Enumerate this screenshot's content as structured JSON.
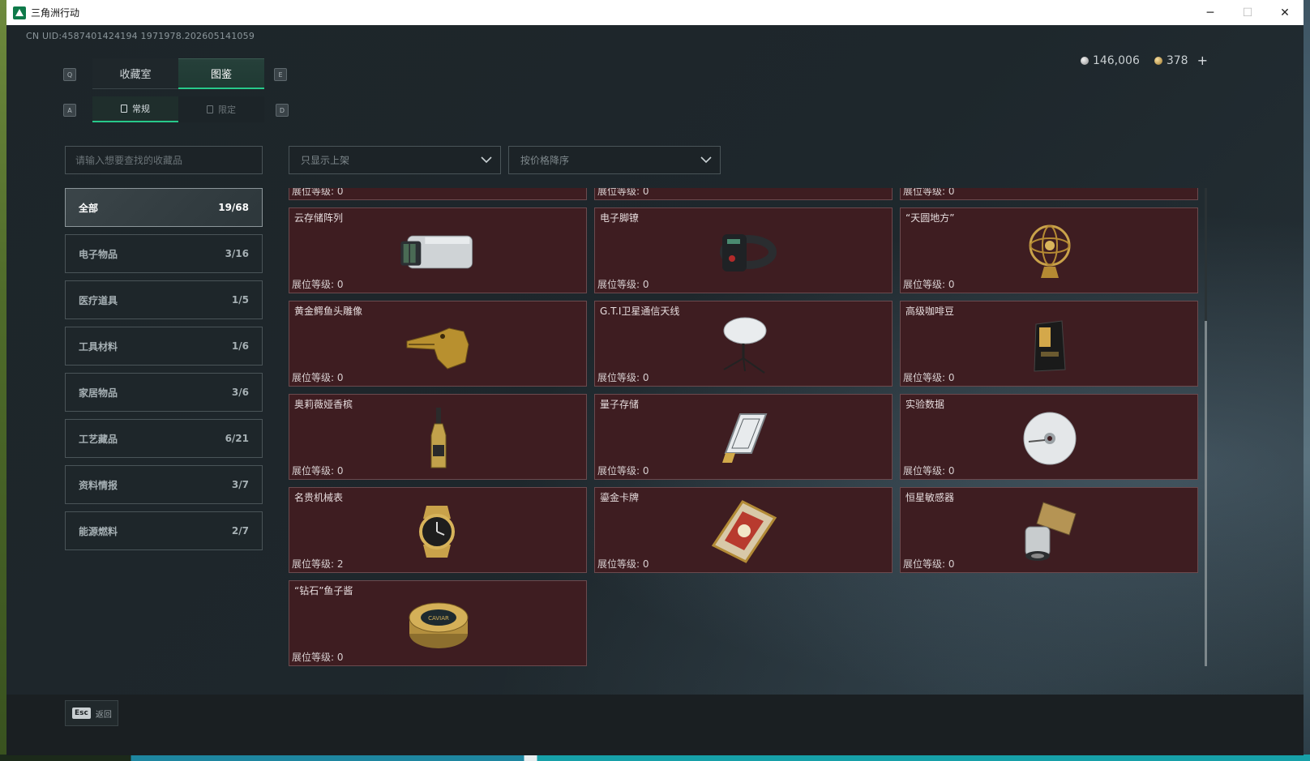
{
  "window": {
    "title": "三角洲行动",
    "controls": {
      "minimize": "─",
      "maximize": "☐",
      "close": "✕"
    }
  },
  "uid": "CN UID:4587401424194 1971978.202605141059",
  "currency": {
    "silver": "146,006",
    "gold": "378",
    "plus": "+"
  },
  "keys": {
    "q": "Q",
    "e": "E",
    "a": "A",
    "d": "D"
  },
  "tabs": [
    {
      "label": "收藏室"
    },
    {
      "label": "图鉴"
    }
  ],
  "subtabs": [
    {
      "label": "常规"
    },
    {
      "label": "限定"
    }
  ],
  "search": {
    "placeholder": "请输入想要查找的收藏品"
  },
  "filters": {
    "shelf": "只显示上架",
    "sort": "按价格降序"
  },
  "categories": [
    {
      "label": "全部",
      "count": "19/68"
    },
    {
      "label": "电子物品",
      "count": "3/16"
    },
    {
      "label": "医疗道具",
      "count": "1/5"
    },
    {
      "label": "工具材料",
      "count": "1/6"
    },
    {
      "label": "家居物品",
      "count": "3/6"
    },
    {
      "label": "工艺藏品",
      "count": "6/21"
    },
    {
      "label": "资料情报",
      "count": "3/7"
    },
    {
      "label": "能源燃料",
      "count": "2/7"
    }
  ],
  "level_prefix": "展位等级: ",
  "items": [
    {
      "name": "",
      "level": "0",
      "icon": "partial-item"
    },
    {
      "name": "",
      "level": "0",
      "icon": "partial-item"
    },
    {
      "name": "",
      "level": "0",
      "icon": "partial-item"
    },
    {
      "name": "云存储阵列",
      "level": "0",
      "icon": "server-array-icon"
    },
    {
      "name": "电子脚镣",
      "level": "0",
      "icon": "ankle-monitor-icon"
    },
    {
      "name": "“天圆地方”",
      "level": "0",
      "icon": "armillary-sphere-icon"
    },
    {
      "name": "黄金鳄鱼头雕像",
      "level": "0",
      "icon": "crocodile-statue-icon"
    },
    {
      "name": "G.T.I卫星通信天线",
      "level": "0",
      "icon": "satellite-antenna-icon"
    },
    {
      "name": "高级咖啡豆",
      "level": "0",
      "icon": "coffee-bag-icon"
    },
    {
      "name": "奥莉薇娅香槟",
      "level": "0",
      "icon": "champagne-bottle-icon"
    },
    {
      "name": "量子存储",
      "level": "0",
      "icon": "usb-drive-icon"
    },
    {
      "name": "实验数据",
      "level": "0",
      "icon": "disc-icon"
    },
    {
      "name": "名贵机械表",
      "level": "2",
      "icon": "watch-icon"
    },
    {
      "name": "鎏金卡牌",
      "level": "0",
      "icon": "gilded-card-icon"
    },
    {
      "name": "恒星敏感器",
      "level": "0",
      "icon": "star-sensor-icon"
    },
    {
      "name": "“钻石”鱼子酱",
      "level": "0",
      "icon": "caviar-tin-icon"
    }
  ],
  "caviar_label": "CAVIAR",
  "footer": {
    "esc_key": "Esc",
    "back_label": "返回"
  },
  "colors": {
    "accent": "#27c98a",
    "card_bg": "#3e1d21",
    "card_border": "#6b4a4e",
    "gold": "#c9a24a"
  }
}
